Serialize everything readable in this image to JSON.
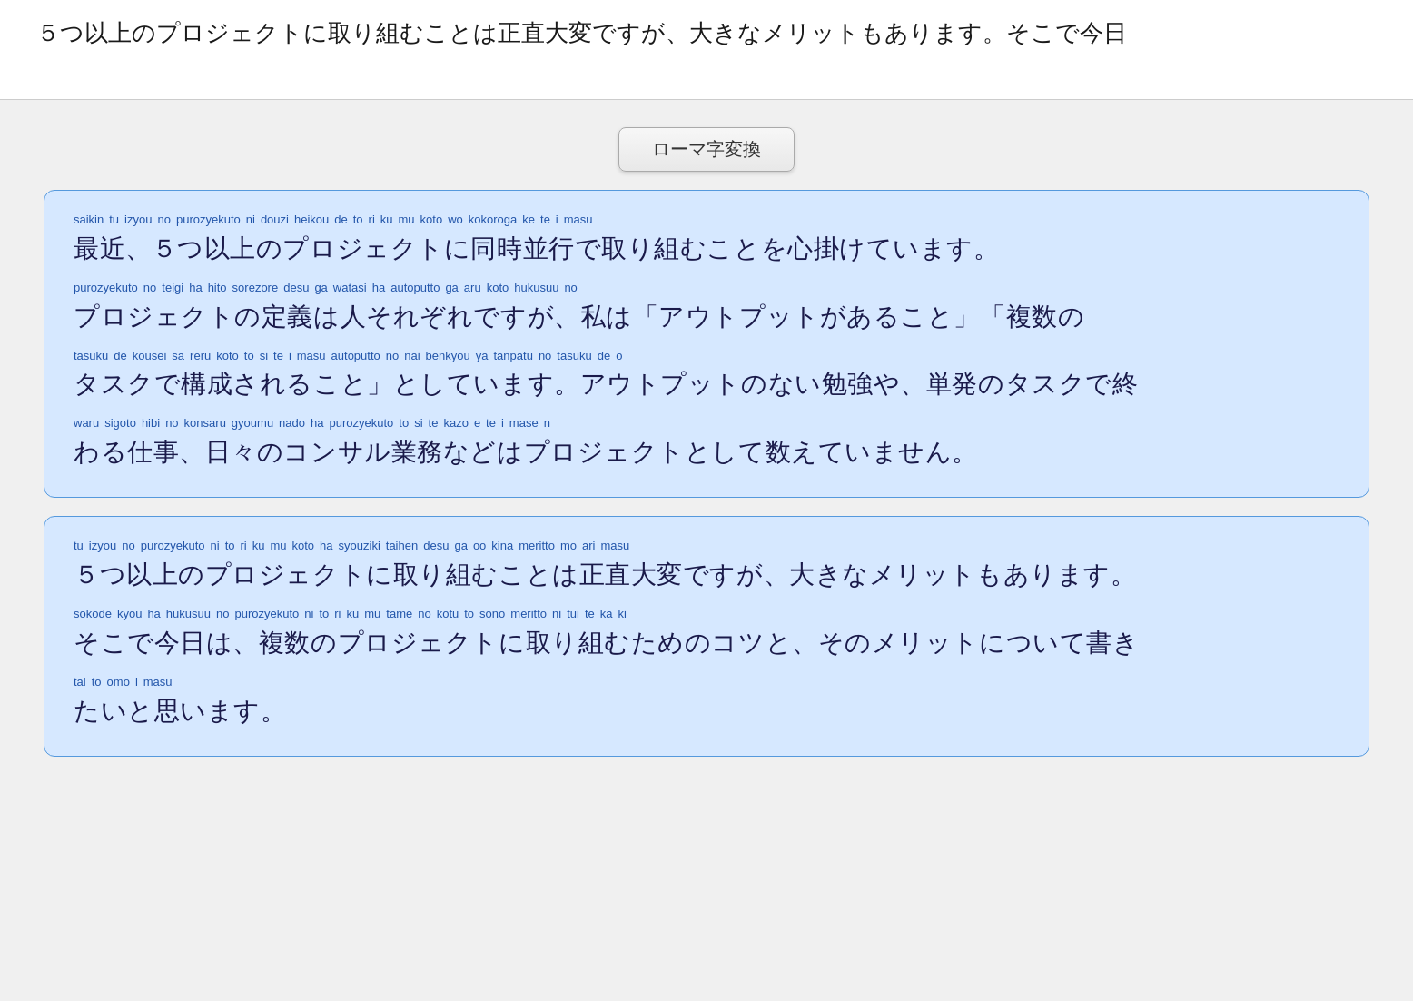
{
  "header": {
    "textarea_value": "５つ以上のプロジェクトに取り組むことは正直大変ですが、大きなメリットもあります。そこで今日"
  },
  "button": {
    "label": "ローマ字変換"
  },
  "block1": {
    "lines": [
      {
        "romaji": [
          "saikin",
          "tu",
          "izyou",
          "no",
          "purozyekuto",
          "ni",
          "douzi",
          "heikou",
          "de",
          "to",
          "ri",
          "ku",
          "mu",
          "koto",
          "wo",
          "kokoroga",
          "ke",
          "te",
          "i",
          "masu"
        ],
        "kanji": "最近、５つ以上のプロジェクトに同時並行で取り組むことを心掛けています。"
      },
      {
        "romaji": [
          "purozyekuto",
          "no",
          "teigi",
          "ha",
          "hito",
          "sorezore",
          "desu",
          "ga",
          "watasi",
          "ha",
          "autoputto",
          "ga",
          "aru",
          "koto",
          "hukusuu",
          "no"
        ],
        "kanji": "プロジェクトの定義は人それぞれですが、私は「アウトプットがあること」「複数の"
      },
      {
        "romaji": [
          "tasuku",
          "de",
          "kousei",
          "sa",
          "reru",
          "koto",
          "to",
          "si",
          "te",
          "i",
          "masu",
          "autoputto",
          "no",
          "nai",
          "benkyou",
          "ya",
          "tanpatu",
          "no",
          "tasuku",
          "de",
          "o"
        ],
        "kanji": "タスクで構成されること」としています。アウトプットのない勉強や、単発のタスクで終"
      },
      {
        "romaji": [
          "waru",
          "sigoto",
          "hibi",
          "no",
          "konsaru",
          "gyoumu",
          "nado",
          "ha",
          "purozyekuto",
          "to",
          "si",
          "te",
          "kazo",
          "e",
          "te",
          "i",
          "mase",
          "n"
        ],
        "kanji": "わる仕事、日々のコンサル業務などはプロジェクトとして数えていません。"
      }
    ]
  },
  "block2": {
    "lines": [
      {
        "romaji": [
          "tu",
          "izyou",
          "no",
          "purozyekuto",
          "ni",
          "to",
          "ri",
          "ku",
          "mu",
          "koto",
          "ha",
          "syouziki",
          "taihen",
          "desu",
          "ga",
          "oo",
          "kina",
          "meritto",
          "mo",
          "ari",
          "masu"
        ],
        "kanji": "５つ以上のプロジェクトに取り組むことは正直大変ですが、大きなメリットもあります。"
      },
      {
        "romaji": [
          "sokode",
          "kyou",
          "ha",
          "hukusuu",
          "no",
          "purozyekuto",
          "ni",
          "to",
          "ri",
          "ku",
          "mu",
          "tame",
          "no",
          "kotu",
          "to",
          "sono",
          "meritto",
          "ni",
          "tui",
          "te",
          "ka",
          "ki"
        ],
        "kanji": "そこで今日は、複数のプロジェクトに取り組むためのコツと、そのメリットについて書き"
      },
      {
        "romaji": [
          "tai",
          "to",
          "omo",
          "i",
          "masu"
        ],
        "kanji": "たいと思います。"
      }
    ]
  }
}
